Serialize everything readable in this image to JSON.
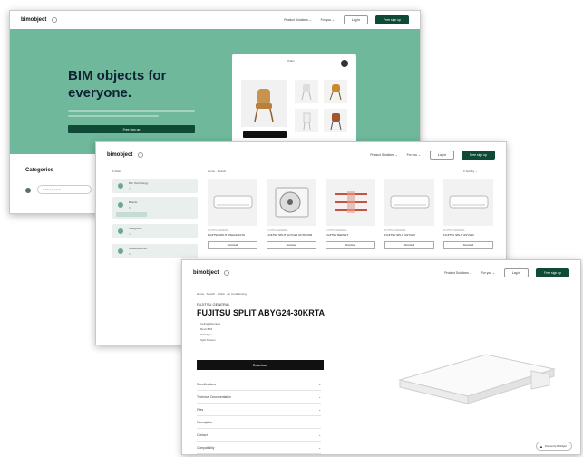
{
  "common": {
    "logo": "bimobject",
    "products_services": "Product Solutions ⌄",
    "for_you": "For you ⌄",
    "login": "Log in",
    "signup": "Free sign up"
  },
  "hero": {
    "headline_1": "BIM objects for",
    "headline_2": "everyone.",
    "cta": "Free sign up",
    "preview_title": "Chairs",
    "categories_title": "Categories",
    "search_placeholder": "Q  Find product"
  },
  "listing": {
    "filter_label": "≡ Filter",
    "breadcrumb": "Home · Search",
    "sort_label": "≡ Sort by ⌄",
    "filters": [
      {
        "title": "Bim Technology",
        "sub": "7"
      },
      {
        "title": "Brands",
        "sub": "8"
      },
      {
        "title": "Categories",
        "sub": "4"
      },
      {
        "title": "Measurements",
        "sub": "5"
      }
    ],
    "products": [
      {
        "brand": "FUJITSU GENERAL",
        "name": "FUJITSU SPLIT ASHG24KLTA",
        "download": "Download"
      },
      {
        "brand": "FUJITSU GENERAL",
        "name": "FUJITSU SPLIT AOYG24 OUTDOOR",
        "download": "Download"
      },
      {
        "brand": "FUJITSU GENERAL",
        "name": "FUJITSU REFNET",
        "download": "Download"
      },
      {
        "brand": "FUJITSU GENERAL",
        "name": "FUJITSU SPLIT ASYG09",
        "download": "Download"
      },
      {
        "brand": "FUJITSU GENERAL",
        "name": "FUJITSU SPLIT ASYG12",
        "download": "Download"
      }
    ]
  },
  "detail": {
    "breadcrumb": "Home · Search · HVAC · Air Conditioning",
    "brand": "FUJITSU GENERAL",
    "title": "FUJITSU SPLIT ABYG24-30KRTA",
    "bullets": [
      "Ceiling Mounted",
      "Revit BIM",
      "Wall Type",
      "Split System"
    ],
    "download": "Download",
    "accordion": [
      "Specifications",
      "Technical Documentation",
      "Files",
      "Description",
      "Contact",
      "Compatibility"
    ],
    "badge": "Powered by BIMobject"
  },
  "colors": {
    "brand_green": "#0f4a36",
    "hero_bg": "#6fb89b",
    "sidebar_bg": "#e8efec"
  }
}
